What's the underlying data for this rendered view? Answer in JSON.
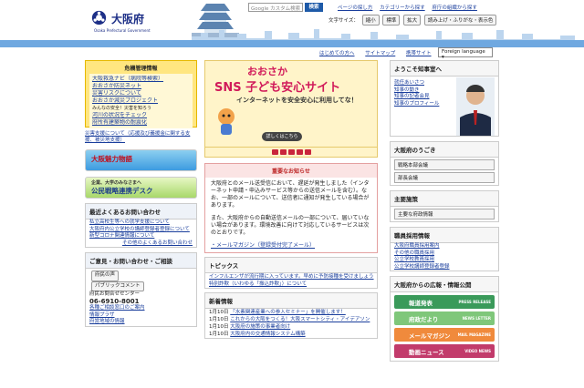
{
  "header": {
    "logo_name": "大阪府",
    "logo_en": "Osaka Prefectural Government",
    "search_placeholder": "Google カスタム検索",
    "search_button": "検索",
    "links": [
      "ページの探し方",
      "カテゴリーから探す",
      "府庁の組織から探す"
    ],
    "font_size_label": "文字サイズ：",
    "font_buttons": [
      "縮小",
      "標準",
      "拡大"
    ],
    "read_aloud": "読み上げ・ふりがな・表示色"
  },
  "nav": {
    "items": [
      "はじめての方へ",
      "サイトマップ",
      "携帯サイト"
    ],
    "language": "Foreign language"
  },
  "crisis": {
    "title": "危機管理情報",
    "items": [
      "大阪救急ナビ（病院等検索）",
      "おおさか防災ネット",
      "災害リスクについて",
      "おおさか減災プロジェクト",
      "みんなの安全！災害を知ろう",
      "河川の状況をチェック",
      "府所有建築物の耐震化"
    ]
  },
  "crisis_note": "災害支援について（応援及び義援金に関する支援、被災地支援）",
  "banners": [
    "大阪魅力物語",
    "公民戦略連携デスク"
  ],
  "banner_sub": "企業、大学のみなさまへ",
  "faq": {
    "title": "最近よくあるお問い合わせ",
    "items": [
      "私立高校生等への就学支援について",
      "大阪府内公立学校の講師登録者登録について",
      "新型コロナ関連情報について"
    ],
    "more": "その他のよくあるお問い合わせ"
  },
  "contact": {
    "title": "ご意見・お問い合わせ・ご相談",
    "voice": "府民の声",
    "comment": "パブリックコメント",
    "center": "府民お問合せセンター",
    "phone": "06-6910-8001",
    "links": [
      "各種ご相談窓口のご案内",
      "情報プラザ",
      "府営地域の情報"
    ]
  },
  "hero": {
    "t1": "おおさか",
    "t2": "SNS 子ども安心サイト",
    "t3": "インターネットを安全安心に利用してな！",
    "cta": "詳しくはこちら"
  },
  "important": {
    "title": "重要なお知らせ",
    "p1": "大阪府とのメール送受信において、遅延が発生しました（インターネット申請・申込みサービス等からの送信メールを含む）。なお、一部のメールについて、送信者に通知が発生している場合があります。",
    "p2": "また、大阪府からの自動送信メールの一部について、届いていない場合があります。環境改善に向けて対応しているサービスは次のとおりです。",
    "item": "・メールマガジン（登録受付完了メール）"
  },
  "topics": {
    "title": "トピックス",
    "items": [
      "インフルエンザが流行期に入っています。早めに予防接種を受けましょう",
      "特別詐欺（いわゆる「振込詐欺」）について"
    ]
  },
  "news": {
    "title": "新着情報",
    "dates": [
      "1月10日",
      "1月10日",
      "1月10日",
      "1月10日",
      "1月10日"
    ],
    "items": [
      "「水素関連産業への参入セミナー」を開催します！",
      "これからの大阪をつくる！大阪スマートシティ・アイデアソン",
      "大阪府の施策の事業者向け",
      "大阪府内の交通情報システム構築",
      "防災に関する情報提供"
    ]
  },
  "governor": {
    "title": "ようこそ知事室へ",
    "items": [
      "就任あいさつ",
      "知事の動き",
      "知事の記者会見",
      "知事のプロフィール"
    ]
  },
  "movement": {
    "title": "大阪府のうごき",
    "items": [
      "戦略本部会議",
      "部長会議"
    ]
  },
  "policy": {
    "title": "主要施策",
    "items": [
      "主要な府政情報"
    ]
  },
  "recruit": {
    "title": "職員採用情報",
    "items": [
      "大阪府職員採用案内",
      "その他の職員採用",
      "公立学校教員採用",
      "公立学校講師登録者登録"
    ]
  },
  "pr": {
    "title": "大阪府からの広報・情報公開",
    "items": [
      "報道発表",
      "府政だより",
      "メールマガジン",
      "動画ニュース"
    ],
    "en": [
      "PRESS RELEASE",
      "NEWS LETTER",
      "MAIL MAGAZINE",
      "VIDEO NEWS"
    ],
    "colors": [
      "#3a9a5a",
      "#7fc77a",
      "#f08a3c",
      "#c23b6b"
    ]
  }
}
